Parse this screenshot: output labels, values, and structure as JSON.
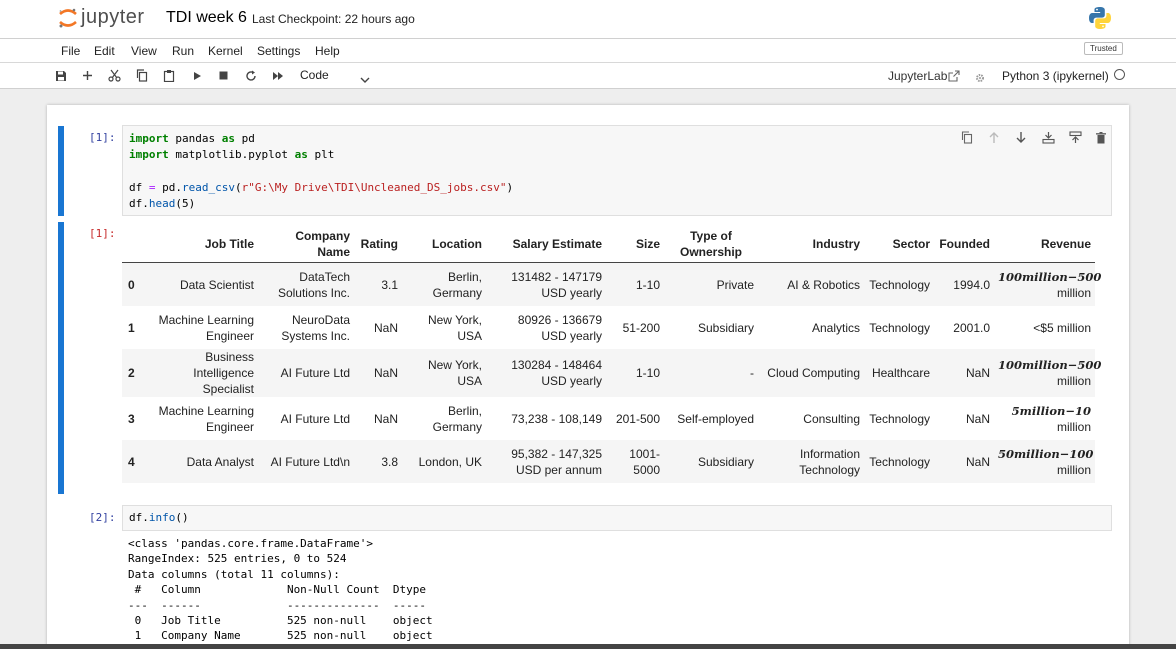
{
  "header": {
    "logo_text": "jupyter",
    "notebook_title": "TDI week 6",
    "checkpoint": "Last Checkpoint: 22 hours ago"
  },
  "menu": {
    "items": [
      "File",
      "Edit",
      "View",
      "Run",
      "Kernel",
      "Settings",
      "Help"
    ],
    "trusted": "Trusted"
  },
  "toolbar": {
    "icons": [
      "save-icon",
      "add-cell-icon",
      "cut-icon",
      "copy-icon",
      "paste-icon",
      "run-icon",
      "stop-icon",
      "restart-icon",
      "fast-forward-icon"
    ],
    "cell_type": "Code",
    "jupyterlab_link": "JupyterLab",
    "kernel_name": "Python 3 (ipykernel)"
  },
  "cell1": {
    "prompt": "[1]:",
    "out_prompt": "[1]:",
    "lines": [
      [
        "import",
        " pandas ",
        "as",
        " pd"
      ],
      [
        "import",
        " matplotlib.pyplot ",
        "as",
        " plt"
      ],
      "",
      "df = pd.read_csv(r\"G:\\My Drive\\TDI\\Uncleaned_DS_jobs.csv\")",
      "df.head(5)"
    ],
    "code": {
      "l1_kw1": "import",
      "l1_mid": " pandas ",
      "l1_kw2": "as",
      "l1_end": " pd",
      "l2_kw1": "import",
      "l2_mid": " matplotlib.pyplot ",
      "l2_kw2": "as",
      "l2_end": " plt",
      "l3_a": "df ",
      "l3_op": "=",
      "l3_b": " pd.",
      "l3_fn": "read_csv",
      "l3_c": "(",
      "l3_str": "r\"G:\\My Drive\\TDI\\Uncleaned_DS_jobs.csv\"",
      "l3_d": ")",
      "l4_a": "df.",
      "l4_fn": "head",
      "l4_b": "(5)"
    }
  },
  "dataframe": {
    "columns": [
      "",
      "Job Title",
      "Company Name",
      "Rating",
      "Location",
      "Salary Estimate",
      "Size",
      "Type of Ownership",
      "Industry",
      "Sector",
      "Founded",
      "Revenue"
    ],
    "rows": [
      {
        "idx": "0",
        "job": "Data Scientist",
        "company": "DataTech Solutions Inc.",
        "rating": "3.1",
        "location": "Berlin, Germany",
        "salary": "131482 - 147179 USD yearly",
        "size": "1-10",
        "ownership": "Private",
        "industry": "AI & Robotics",
        "sector": "Technology",
        "founded": "1994.0",
        "revenue_math": "100million−500",
        "revenue_tail": "million"
      },
      {
        "idx": "1",
        "job": "Machine Learning Engineer",
        "company": "NeuroData Systems Inc.",
        "rating": "NaN",
        "location": "New York, USA",
        "salary": "80926 - 136679 USD yearly",
        "size": "51-200",
        "ownership": "Subsidiary",
        "industry": "Analytics",
        "sector": "Technology",
        "founded": "2001.0",
        "revenue_math": "",
        "revenue_tail": "<$5 million"
      },
      {
        "idx": "2",
        "job": "Business Intelligence Specialist",
        "company": "AI Future Ltd",
        "rating": "NaN",
        "location": "New York, USA",
        "salary": "130284 - 148464 USD yearly",
        "size": "1-10",
        "ownership": "-",
        "industry": "Cloud Computing",
        "sector": "Healthcare",
        "founded": "NaN",
        "revenue_math": "100million−500",
        "revenue_tail": "million"
      },
      {
        "idx": "3",
        "job": "Machine Learning Engineer",
        "company": "AI Future Ltd",
        "rating": "NaN",
        "location": "Berlin, Germany",
        "salary": "73,238 - 108,149",
        "size": "201-500",
        "ownership": "Self-employed",
        "industry": "Consulting",
        "sector": "Technology",
        "founded": "NaN",
        "revenue_math": "5million−10",
        "revenue_tail": "million"
      },
      {
        "idx": "4",
        "job": "Data Analyst",
        "company": "AI Future Ltd\\n",
        "rating": "3.8",
        "location": "London, UK",
        "salary": "95,382 - 147,325 USD per annum",
        "size": "1001-5000",
        "ownership": "Subsidiary",
        "industry": "Information Technology",
        "sector": "Technology",
        "founded": "NaN",
        "revenue_math": "50million−100",
        "revenue_tail": "million"
      }
    ]
  },
  "cell2": {
    "prompt": "[2]:",
    "code_a": "df.",
    "code_fn": "info",
    "code_b": "()",
    "output": "<class 'pandas.core.frame.DataFrame'>\nRangeIndex: 525 entries, 0 to 524\nData columns (total 11 columns):\n #   Column             Non-Null Count  Dtype \n---  ------             --------------  ----- \n 0   Job Title          525 non-null    object\n 1   Company Name       525 non-null    object"
  }
}
